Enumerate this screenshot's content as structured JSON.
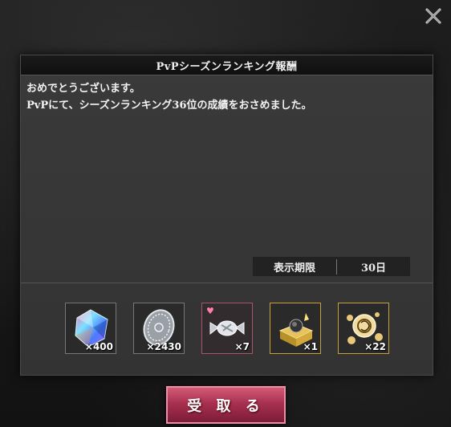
{
  "dialog": {
    "title": "PvPシーズンランキング報酬",
    "message_line1": "おめでとうございます。",
    "message_line2": "PvPにて、シーズンランキング36位の成績をおさめました。",
    "duration_label": "表示期限",
    "duration_value": "30日"
  },
  "rewards": [
    {
      "icon": "crystal-gem-icon",
      "count": "×400"
    },
    {
      "icon": "silver-coin-icon",
      "count": "×2430"
    },
    {
      "icon": "candy-icon",
      "count": "×7"
    },
    {
      "icon": "treasure-box-icon",
      "count": "×1"
    },
    {
      "icon": "gold-ornament-icon",
      "count": "×22"
    }
  ],
  "receive_button": "受 取 る",
  "colors": {
    "button_accent": "#a8304f",
    "dialog_bg": "#383838",
    "gold_frame": "#c9a03a"
  }
}
